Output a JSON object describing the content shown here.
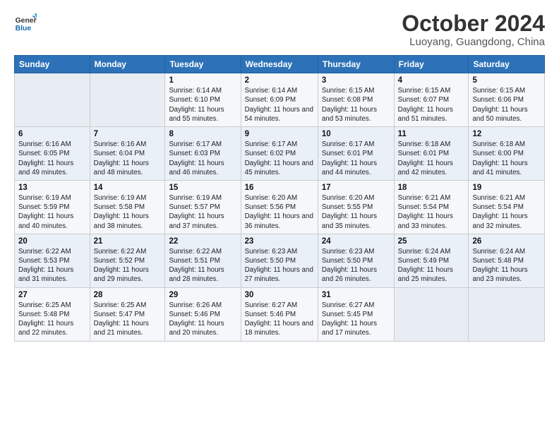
{
  "header": {
    "logo_line1": "General",
    "logo_line2": "Blue",
    "month": "October 2024",
    "location": "Luoyang, Guangdong, China"
  },
  "weekdays": [
    "Sunday",
    "Monday",
    "Tuesday",
    "Wednesday",
    "Thursday",
    "Friday",
    "Saturday"
  ],
  "weeks": [
    [
      {
        "day": "",
        "info": ""
      },
      {
        "day": "",
        "info": ""
      },
      {
        "day": "1",
        "info": "Sunrise: 6:14 AM\nSunset: 6:10 PM\nDaylight: 11 hours and 55 minutes."
      },
      {
        "day": "2",
        "info": "Sunrise: 6:14 AM\nSunset: 6:09 PM\nDaylight: 11 hours and 54 minutes."
      },
      {
        "day": "3",
        "info": "Sunrise: 6:15 AM\nSunset: 6:08 PM\nDaylight: 11 hours and 53 minutes."
      },
      {
        "day": "4",
        "info": "Sunrise: 6:15 AM\nSunset: 6:07 PM\nDaylight: 11 hours and 51 minutes."
      },
      {
        "day": "5",
        "info": "Sunrise: 6:15 AM\nSunset: 6:06 PM\nDaylight: 11 hours and 50 minutes."
      }
    ],
    [
      {
        "day": "6",
        "info": "Sunrise: 6:16 AM\nSunset: 6:05 PM\nDaylight: 11 hours and 49 minutes."
      },
      {
        "day": "7",
        "info": "Sunrise: 6:16 AM\nSunset: 6:04 PM\nDaylight: 11 hours and 48 minutes."
      },
      {
        "day": "8",
        "info": "Sunrise: 6:17 AM\nSunset: 6:03 PM\nDaylight: 11 hours and 46 minutes."
      },
      {
        "day": "9",
        "info": "Sunrise: 6:17 AM\nSunset: 6:02 PM\nDaylight: 11 hours and 45 minutes."
      },
      {
        "day": "10",
        "info": "Sunrise: 6:17 AM\nSunset: 6:01 PM\nDaylight: 11 hours and 44 minutes."
      },
      {
        "day": "11",
        "info": "Sunrise: 6:18 AM\nSunset: 6:01 PM\nDaylight: 11 hours and 42 minutes."
      },
      {
        "day": "12",
        "info": "Sunrise: 6:18 AM\nSunset: 6:00 PM\nDaylight: 11 hours and 41 minutes."
      }
    ],
    [
      {
        "day": "13",
        "info": "Sunrise: 6:19 AM\nSunset: 5:59 PM\nDaylight: 11 hours and 40 minutes."
      },
      {
        "day": "14",
        "info": "Sunrise: 6:19 AM\nSunset: 5:58 PM\nDaylight: 11 hours and 38 minutes."
      },
      {
        "day": "15",
        "info": "Sunrise: 6:19 AM\nSunset: 5:57 PM\nDaylight: 11 hours and 37 minutes."
      },
      {
        "day": "16",
        "info": "Sunrise: 6:20 AM\nSunset: 5:56 PM\nDaylight: 11 hours and 36 minutes."
      },
      {
        "day": "17",
        "info": "Sunrise: 6:20 AM\nSunset: 5:55 PM\nDaylight: 11 hours and 35 minutes."
      },
      {
        "day": "18",
        "info": "Sunrise: 6:21 AM\nSunset: 5:54 PM\nDaylight: 11 hours and 33 minutes."
      },
      {
        "day": "19",
        "info": "Sunrise: 6:21 AM\nSunset: 5:54 PM\nDaylight: 11 hours and 32 minutes."
      }
    ],
    [
      {
        "day": "20",
        "info": "Sunrise: 6:22 AM\nSunset: 5:53 PM\nDaylight: 11 hours and 31 minutes."
      },
      {
        "day": "21",
        "info": "Sunrise: 6:22 AM\nSunset: 5:52 PM\nDaylight: 11 hours and 29 minutes."
      },
      {
        "day": "22",
        "info": "Sunrise: 6:22 AM\nSunset: 5:51 PM\nDaylight: 11 hours and 28 minutes."
      },
      {
        "day": "23",
        "info": "Sunrise: 6:23 AM\nSunset: 5:50 PM\nDaylight: 11 hours and 27 minutes."
      },
      {
        "day": "24",
        "info": "Sunrise: 6:23 AM\nSunset: 5:50 PM\nDaylight: 11 hours and 26 minutes."
      },
      {
        "day": "25",
        "info": "Sunrise: 6:24 AM\nSunset: 5:49 PM\nDaylight: 11 hours and 25 minutes."
      },
      {
        "day": "26",
        "info": "Sunrise: 6:24 AM\nSunset: 5:48 PM\nDaylight: 11 hours and 23 minutes."
      }
    ],
    [
      {
        "day": "27",
        "info": "Sunrise: 6:25 AM\nSunset: 5:48 PM\nDaylight: 11 hours and 22 minutes."
      },
      {
        "day": "28",
        "info": "Sunrise: 6:25 AM\nSunset: 5:47 PM\nDaylight: 11 hours and 21 minutes."
      },
      {
        "day": "29",
        "info": "Sunrise: 6:26 AM\nSunset: 5:46 PM\nDaylight: 11 hours and 20 minutes."
      },
      {
        "day": "30",
        "info": "Sunrise: 6:27 AM\nSunset: 5:46 PM\nDaylight: 11 hours and 18 minutes."
      },
      {
        "day": "31",
        "info": "Sunrise: 6:27 AM\nSunset: 5:45 PM\nDaylight: 11 hours and 17 minutes."
      },
      {
        "day": "",
        "info": ""
      },
      {
        "day": "",
        "info": ""
      }
    ]
  ]
}
